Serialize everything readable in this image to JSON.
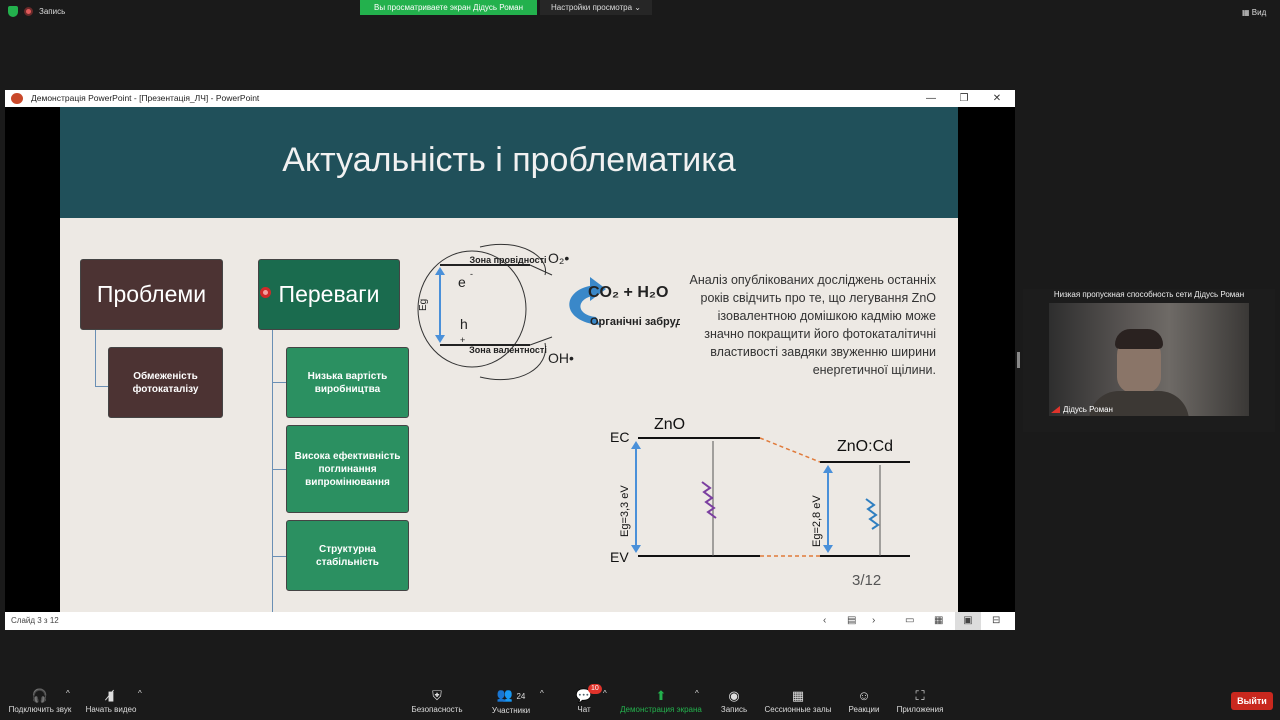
{
  "top": {
    "recording": "Запись",
    "banner": "Вы просматриваете экран Дідусь Роман",
    "view_settings": "Настройки просмотра",
    "view": "Вид"
  },
  "window": {
    "title": "Демонстрація PowerPoint - [Презентація_ЛЧ] - PowerPoint",
    "minimize": "—",
    "restore": "❐",
    "close": "✕"
  },
  "slide": {
    "title": "Актуальність і проблематика",
    "problems": "Проблеми",
    "problem_item": "Обмеженість фотокаталізу",
    "advantages": "Переваги",
    "advantage_items": [
      "Низька вартість виробництва",
      "Висока ефективність поглинання випромінювання",
      "Структурна стабільність"
    ],
    "diagram": {
      "cond_band": "Зона провідності",
      "val_band": "Зона валентності",
      "eg": "Eg",
      "e": "e",
      "h": "h",
      "plus": "+",
      "minus": "-",
      "o2": "O₂•",
      "co2": "CO₂ + H₂O",
      "organic": "Органічні забрудники",
      "oh": "OH•"
    },
    "paragraph": "Аналіз опублікованих досліджень останніх років свідчить про те, що легування ZnO ізовалентною домішкою кадмію може значно покращити його фотокаталітичні властивості завдяки звуженню ширини енергетичної щілини.",
    "band": {
      "zno": "ZnO",
      "znocd": "ZnO:Cd",
      "ec": "EC",
      "ev": "EV",
      "eg1": "Eg=3,3 eV",
      "eg2": "Eg=2,8 eV"
    },
    "page": "3/12"
  },
  "status": {
    "slide": "Слайд 3 з 12"
  },
  "tile": {
    "header": "Низкая пропускная способность сети Дідусь Роман",
    "name": "Дідусь Роман"
  },
  "toolbar": {
    "audio": "Подключить звук",
    "video": "Начать видео",
    "security": "Безопасность",
    "participants": "Участники",
    "participants_count": "24",
    "chat": "Чат",
    "chat_badge": "10",
    "share": "Демонстрация экрана",
    "record": "Запись",
    "rooms": "Сессионные залы",
    "reactions": "Реакции",
    "apps": "Приложения",
    "leave": "Выйти"
  },
  "colors": {
    "zoom_green": "#23b14d",
    "slide_header": "#20505a",
    "leave_red": "#c9281e"
  }
}
